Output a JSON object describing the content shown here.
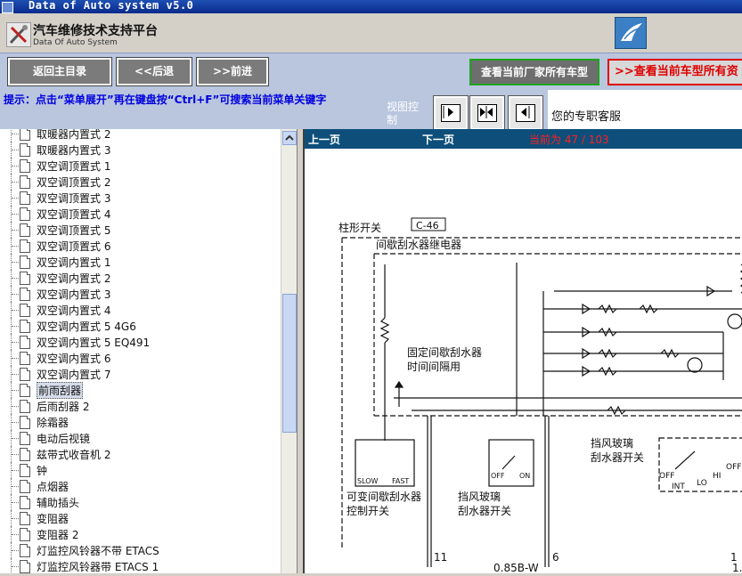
{
  "window": {
    "title": "Data of Auto system v5.0"
  },
  "header": {
    "title": "汽车维修技术支持平台",
    "subtitle": "Data Of Auto System"
  },
  "toolbar": {
    "back_main": "返回主目录",
    "back": "<<后退",
    "forward": ">>前进",
    "all_models": "查看当前厂家所有车型",
    "current_model": "查看当前车型所有资"
  },
  "hint": "提示：点击“菜单展开”再在键盘按“Ctrl+F”可搜索当前菜单关键字",
  "view_control": {
    "label": "视图控制"
  },
  "service": "您的专职客服",
  "tree": {
    "items": [
      {
        "label": "取暖器内置式  2"
      },
      {
        "label": "取暖器内置式  3"
      },
      {
        "label": "双空调顶置式  1"
      },
      {
        "label": "双空调顶置式  2"
      },
      {
        "label": "双空调顶置式  3"
      },
      {
        "label": "双空调顶置式  4"
      },
      {
        "label": "双空调顶置式  5"
      },
      {
        "label": "双空调顶置式  6"
      },
      {
        "label": "双空调内置式  1"
      },
      {
        "label": "双空调内置式  2"
      },
      {
        "label": "双空调内置式  3"
      },
      {
        "label": "双空调内置式  4"
      },
      {
        "label": "双空调内置式  5 4G6"
      },
      {
        "label": "双空调内置式  5 EQ491"
      },
      {
        "label": "双空调内置式  6"
      },
      {
        "label": "双空调内置式  7"
      },
      {
        "label": "前雨刮器",
        "selected": true
      },
      {
        "label": "后雨刮器  2"
      },
      {
        "label": "除霜器"
      },
      {
        "label": "电动后视镜"
      },
      {
        "label": "兹带式收音机  2"
      },
      {
        "label": "钟"
      },
      {
        "label": "点烟器"
      },
      {
        "label": "辅助插头"
      },
      {
        "label": "变阻器"
      },
      {
        "label": "变阻器  2"
      },
      {
        "label": "灯监控风铃器不带  ETACS"
      },
      {
        "label": "灯监控风铃器带  ETACS 1"
      }
    ]
  },
  "viewer": {
    "prev": "上一页",
    "next": "下一页",
    "current": "当前为  47 / 103"
  },
  "diagram": {
    "column_switch": "柱形开关",
    "connector": "C-46",
    "relay": "间歇刮水器继电器",
    "fixed_intermittent": "固定间歇刮水器",
    "time_interval": "时间间隔用",
    "slow": "SLOW",
    "fast": "FAST",
    "variable_control_1": "可变间歇刮水器",
    "variable_control_2": "控制开关",
    "off": "OFF",
    "on": "ON",
    "washer_switch_1": "挡风玻璃",
    "washer_switch_2": "刮水器开关",
    "wiper_switch_1": "挡风玻璃",
    "wiper_switch_2": "刮水器开关",
    "off2": "OFF",
    "int": "INT",
    "lo": "LO",
    "hi": "HI",
    "off3": "OFF",
    "pin_11": "11",
    "pin_6": "6",
    "wire": "0.85B-W",
    "pin_1": "1",
    "pin_1b": "1."
  }
}
